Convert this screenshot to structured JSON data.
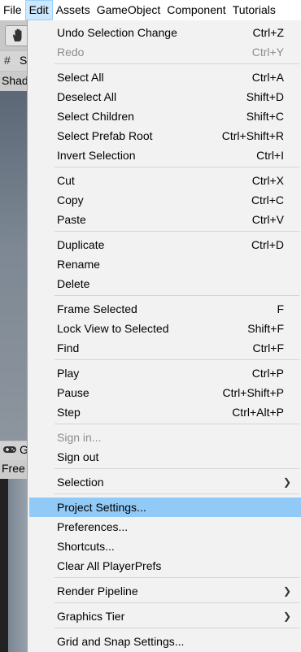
{
  "menubar": {
    "items": [
      "File",
      "Edit",
      "Assets",
      "GameObject",
      "Component",
      "Tutorials"
    ]
  },
  "background": {
    "scene_tab_label": "S",
    "scene_sub_label": "Shad",
    "game_tab_label": "G",
    "game_sub_label": "Free"
  },
  "edit_menu": {
    "undo": {
      "label": "Undo Selection Change",
      "shortcut": "Ctrl+Z"
    },
    "redo": {
      "label": "Redo",
      "shortcut": "Ctrl+Y"
    },
    "select_all": {
      "label": "Select All",
      "shortcut": "Ctrl+A"
    },
    "deselect_all": {
      "label": "Deselect All",
      "shortcut": "Shift+D"
    },
    "select_children": {
      "label": "Select Children",
      "shortcut": "Shift+C"
    },
    "select_prefab_root": {
      "label": "Select Prefab Root",
      "shortcut": "Ctrl+Shift+R"
    },
    "invert_selection": {
      "label": "Invert Selection",
      "shortcut": "Ctrl+I"
    },
    "cut": {
      "label": "Cut",
      "shortcut": "Ctrl+X"
    },
    "copy": {
      "label": "Copy",
      "shortcut": "Ctrl+C"
    },
    "paste": {
      "label": "Paste",
      "shortcut": "Ctrl+V"
    },
    "duplicate": {
      "label": "Duplicate",
      "shortcut": "Ctrl+D"
    },
    "rename": {
      "label": "Rename"
    },
    "delete": {
      "label": "Delete"
    },
    "frame_selected": {
      "label": "Frame Selected",
      "shortcut": "F"
    },
    "lock_view": {
      "label": "Lock View to Selected",
      "shortcut": "Shift+F"
    },
    "find": {
      "label": "Find",
      "shortcut": "Ctrl+F"
    },
    "play": {
      "label": "Play",
      "shortcut": "Ctrl+P"
    },
    "pause": {
      "label": "Pause",
      "shortcut": "Ctrl+Shift+P"
    },
    "step": {
      "label": "Step",
      "shortcut": "Ctrl+Alt+P"
    },
    "sign_in": {
      "label": "Sign in..."
    },
    "sign_out": {
      "label": "Sign out"
    },
    "selection": {
      "label": "Selection"
    },
    "project_settings": {
      "label": "Project Settings..."
    },
    "preferences": {
      "label": "Preferences..."
    },
    "shortcuts": {
      "label": "Shortcuts..."
    },
    "clear_playerprefs": {
      "label": "Clear All PlayerPrefs"
    },
    "render_pipeline": {
      "label": "Render Pipeline"
    },
    "graphics_tier": {
      "label": "Graphics Tier"
    },
    "grid_snap": {
      "label": "Grid and Snap Settings..."
    }
  },
  "colors": {
    "highlight": "#91c9f7",
    "menu_bg": "#f2f2f2",
    "active_menubar_item": "#cce8ff"
  }
}
